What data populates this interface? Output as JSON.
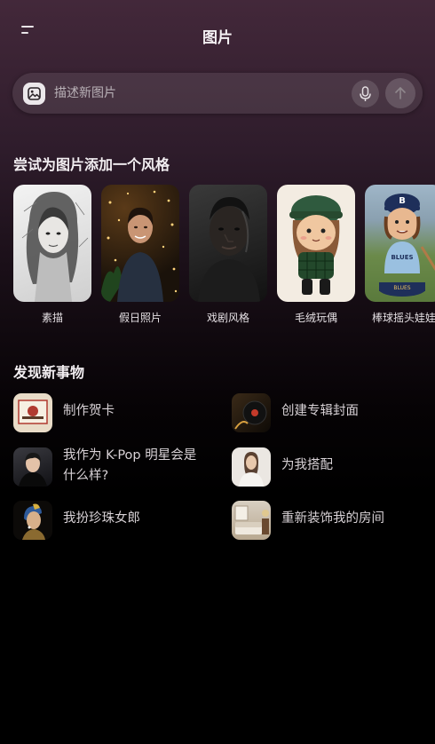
{
  "header": {
    "title": "图片",
    "menu_icon": "menu-icon"
  },
  "search": {
    "placeholder": "描述新图片",
    "image_icon": "image-upload-icon",
    "mic_icon": "microphone-icon",
    "send_icon": "arrow-up-icon"
  },
  "styles_section": {
    "title": "尝试为图片添加一个风格",
    "items": [
      {
        "label": "素描"
      },
      {
        "label": "假日照片"
      },
      {
        "label": "戏剧风格"
      },
      {
        "label": "毛绒玩偶"
      },
      {
        "label": "棒球摇头娃娃"
      }
    ]
  },
  "discover_section": {
    "title": "发现新事物",
    "items": [
      {
        "label": "制作贺卡"
      },
      {
        "label": "创建专辑封面"
      },
      {
        "label_line1": "我作为 K-Pop 明星会是",
        "label_line2": "什么样?"
      },
      {
        "label": "为我搭配"
      },
      {
        "label": "我扮珍珠女郎"
      },
      {
        "label": "重新装饰我的房间"
      }
    ]
  },
  "colors": {
    "background_top": "#43283a",
    "background_bottom": "#000000",
    "text_primary": "#f4f0f3",
    "text_secondary": "#d8d2d6"
  }
}
